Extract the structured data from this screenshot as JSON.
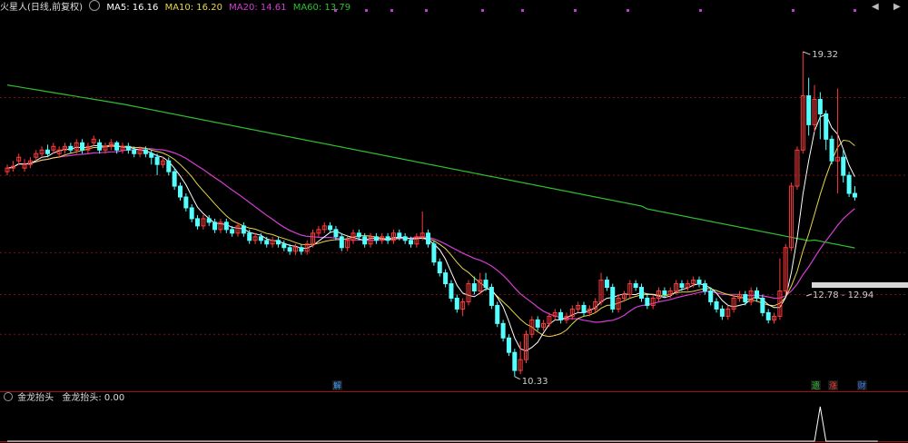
{
  "header": {
    "stock_name": "火星人(日线,前复权)",
    "ma5_label": "MA5: 16.16",
    "ma10_label": "MA10: 16.20",
    "ma20_label": "MA20: 14.61",
    "ma60_label": "MA60: 13.79",
    "prev_arrow": "◀",
    "next_arrow": "▶"
  },
  "colors": {
    "up": "#ff3b3b",
    "down": "#54ffff",
    "ma5": "#ffffff",
    "ma10": "#e8d64a",
    "ma20": "#d43ed4",
    "ma60": "#2fc02f",
    "grid": "#7a1010",
    "label": "#cfcfcf"
  },
  "annotations": {
    "high_label": "19.32",
    "low_label": "10.33",
    "range_label": "12.78 - 12.94"
  },
  "markers": [
    {
      "text": "解",
      "color": "#3fa0ff",
      "index": 57
    },
    {
      "text": "遗",
      "color": "#2fc02f",
      "index": 140
    },
    {
      "text": "涨",
      "color": "#ff3b3b",
      "index": 143
    },
    {
      "text": "财",
      "color": "#3f7fff",
      "index": 148
    }
  ],
  "indicator": {
    "name": "金龙抬头",
    "value_label": "金龙抬头: 0.00"
  },
  "chart_data": {
    "type": "candlestick",
    "ylim": [
      10.0,
      20.4
    ],
    "grid_levels": [
      18.05,
      15.9,
      13.76,
      12.6,
      11.5
    ],
    "candles": [
      [
        16.0,
        16.1,
        16.2,
        15.9
      ],
      [
        16.1,
        16.15,
        16.3,
        16.0
      ],
      [
        16.3,
        16.4,
        16.5,
        16.2
      ],
      [
        16.1,
        16.2,
        16.35,
        16.0
      ],
      [
        16.2,
        16.3,
        16.4,
        16.1
      ],
      [
        16.4,
        16.5,
        16.6,
        16.3
      ],
      [
        16.5,
        16.6,
        16.7,
        16.4
      ],
      [
        16.6,
        16.5,
        16.75,
        16.4
      ],
      [
        16.6,
        16.7,
        16.8,
        16.5
      ],
      [
        16.5,
        16.6,
        16.7,
        16.4
      ],
      [
        16.6,
        16.7,
        16.8,
        16.5
      ],
      [
        16.7,
        16.6,
        16.8,
        16.5
      ],
      [
        16.6,
        16.8,
        16.9,
        16.5
      ],
      [
        16.8,
        16.6,
        16.9,
        16.5
      ],
      [
        16.6,
        16.7,
        16.8,
        16.5
      ],
      [
        16.8,
        16.9,
        17.0,
        16.7
      ],
      [
        16.8,
        16.6,
        16.9,
        16.5
      ],
      [
        16.6,
        16.7,
        16.8,
        16.5
      ],
      [
        16.7,
        16.8,
        16.9,
        16.6
      ],
      [
        16.8,
        16.6,
        16.85,
        16.5
      ],
      [
        16.6,
        16.7,
        16.8,
        16.5
      ],
      [
        16.7,
        16.6,
        16.8,
        16.5
      ],
      [
        16.6,
        16.5,
        16.7,
        16.4
      ],
      [
        16.5,
        16.6,
        16.7,
        16.4
      ],
      [
        16.6,
        16.5,
        16.7,
        16.4
      ],
      [
        16.5,
        16.4,
        16.6,
        16.2
      ],
      [
        16.4,
        16.2,
        16.5,
        15.9
      ],
      [
        16.2,
        16.3,
        16.4,
        16.1
      ],
      [
        16.3,
        16.0,
        16.4,
        15.9
      ],
      [
        16.0,
        15.6,
        16.1,
        15.5
      ],
      [
        15.6,
        15.3,
        15.7,
        15.2
      ],
      [
        15.3,
        15.0,
        15.4,
        14.9
      ],
      [
        15.0,
        14.7,
        15.1,
        14.6
      ],
      [
        14.7,
        14.5,
        14.8,
        14.4
      ],
      [
        14.5,
        14.7,
        14.8,
        14.4
      ],
      [
        14.7,
        14.6,
        14.8,
        14.5
      ],
      [
        14.6,
        14.4,
        14.7,
        14.3
      ],
      [
        14.4,
        14.6,
        14.7,
        14.3
      ],
      [
        14.6,
        14.4,
        14.7,
        14.3
      ],
      [
        14.4,
        14.3,
        14.5,
        14.2
      ],
      [
        14.3,
        14.5,
        14.6,
        14.2
      ],
      [
        14.5,
        14.3,
        14.6,
        14.2
      ],
      [
        14.3,
        14.1,
        14.4,
        14.0
      ],
      [
        14.1,
        14.2,
        14.3,
        14.0
      ],
      [
        14.2,
        14.1,
        14.3,
        14.0
      ],
      [
        14.1,
        14.0,
        14.2,
        13.9
      ],
      [
        14.0,
        14.1,
        14.2,
        13.9
      ],
      [
        14.1,
        14.0,
        14.2,
        13.9
      ],
      [
        14.0,
        13.9,
        14.1,
        13.8
      ],
      [
        13.9,
        13.8,
        14.0,
        13.7
      ],
      [
        13.8,
        13.9,
        14.0,
        13.7
      ],
      [
        13.9,
        13.8,
        14.0,
        13.7
      ],
      [
        13.8,
        14.0,
        14.1,
        13.7
      ],
      [
        14.0,
        14.3,
        14.4,
        13.9
      ],
      [
        14.3,
        14.4,
        14.5,
        14.2
      ],
      [
        14.4,
        14.5,
        14.6,
        14.3
      ],
      [
        14.5,
        14.4,
        14.6,
        14.3
      ],
      [
        14.4,
        14.2,
        14.5,
        14.1
      ],
      [
        14.2,
        13.9,
        14.3,
        13.8
      ],
      [
        13.9,
        14.1,
        14.2,
        13.8
      ],
      [
        14.1,
        14.3,
        14.4,
        14.0
      ],
      [
        14.3,
        14.2,
        14.4,
        14.1
      ],
      [
        14.2,
        14.0,
        14.3,
        13.9
      ],
      [
        14.0,
        14.2,
        14.3,
        13.9
      ],
      [
        14.2,
        14.1,
        14.3,
        14.0
      ],
      [
        14.1,
        14.2,
        14.3,
        14.0
      ],
      [
        14.2,
        14.1,
        14.3,
        14.0
      ],
      [
        14.1,
        14.3,
        14.4,
        14.0
      ],
      [
        14.3,
        14.2,
        14.4,
        14.1
      ],
      [
        14.2,
        14.1,
        14.3,
        14.0
      ],
      [
        14.1,
        14.0,
        14.2,
        13.9
      ],
      [
        14.0,
        14.2,
        14.3,
        13.9
      ],
      [
        14.2,
        14.3,
        14.9,
        14.1
      ],
      [
        14.3,
        14.0,
        14.4,
        13.9
      ],
      [
        14.0,
        13.5,
        14.1,
        13.4
      ],
      [
        13.5,
        13.2,
        13.6,
        13.1
      ],
      [
        13.2,
        12.9,
        13.3,
        12.8
      ],
      [
        12.9,
        12.5,
        13.0,
        12.4
      ],
      [
        12.5,
        12.2,
        12.6,
        12.1
      ],
      [
        12.2,
        12.4,
        12.5,
        12.0
      ],
      [
        12.4,
        12.9,
        13.0,
        12.3
      ],
      [
        12.9,
        12.7,
        13.1,
        12.6
      ],
      [
        12.7,
        13.0,
        13.2,
        12.6
      ],
      [
        13.0,
        12.8,
        13.2,
        12.7
      ],
      [
        12.8,
        12.3,
        12.9,
        12.2
      ],
      [
        12.3,
        11.8,
        12.4,
        11.7
      ],
      [
        11.8,
        11.4,
        11.9,
        11.3
      ],
      [
        11.4,
        11.0,
        11.5,
        10.9
      ],
      [
        11.0,
        10.5,
        11.1,
        10.33
      ],
      [
        10.5,
        10.8,
        11.3,
        10.4
      ],
      [
        10.8,
        11.5,
        11.6,
        10.7
      ],
      [
        11.5,
        11.9,
        12.0,
        11.4
      ],
      [
        11.9,
        11.7,
        12.0,
        11.6
      ],
      [
        11.7,
        11.8,
        11.9,
        11.6
      ],
      [
        11.8,
        12.0,
        12.1,
        11.7
      ],
      [
        12.0,
        12.1,
        12.2,
        11.9
      ],
      [
        12.1,
        11.9,
        12.2,
        11.8
      ],
      [
        11.9,
        12.0,
        12.1,
        11.8
      ],
      [
        12.0,
        12.2,
        12.3,
        11.9
      ],
      [
        12.2,
        12.3,
        12.4,
        12.1
      ],
      [
        12.3,
        12.1,
        12.4,
        12.0
      ],
      [
        12.1,
        12.2,
        12.3,
        12.0
      ],
      [
        12.2,
        12.4,
        12.5,
        12.1
      ],
      [
        12.4,
        13.0,
        13.2,
        12.3
      ],
      [
        13.0,
        12.8,
        13.1,
        12.7
      ],
      [
        12.8,
        12.2,
        12.9,
        12.1
      ],
      [
        12.2,
        12.5,
        12.6,
        12.1
      ],
      [
        12.5,
        12.6,
        12.7,
        12.4
      ],
      [
        12.6,
        12.9,
        13.0,
        12.5
      ],
      [
        12.9,
        12.8,
        13.0,
        12.7
      ],
      [
        12.8,
        12.5,
        12.9,
        12.4
      ],
      [
        12.5,
        12.3,
        12.6,
        12.2
      ],
      [
        12.3,
        12.5,
        12.6,
        12.2
      ],
      [
        12.5,
        12.7,
        12.8,
        12.4
      ],
      [
        12.7,
        12.6,
        12.8,
        12.5
      ],
      [
        12.6,
        12.7,
        12.8,
        12.5
      ],
      [
        12.7,
        12.9,
        13.0,
        12.6
      ],
      [
        12.9,
        12.8,
        13.0,
        12.7
      ],
      [
        12.8,
        12.9,
        13.0,
        12.7
      ],
      [
        12.9,
        13.0,
        13.1,
        12.8
      ],
      [
        13.0,
        12.9,
        13.1,
        12.8
      ],
      [
        12.9,
        12.7,
        13.0,
        12.6
      ],
      [
        12.7,
        12.4,
        12.8,
        12.3
      ],
      [
        12.4,
        12.2,
        12.5,
        12.1
      ],
      [
        12.2,
        12.0,
        12.3,
        11.9
      ],
      [
        12.0,
        12.2,
        12.3,
        11.9
      ],
      [
        12.2,
        12.5,
        12.6,
        12.1
      ],
      [
        12.5,
        12.6,
        12.7,
        12.4
      ],
      [
        12.6,
        12.4,
        12.7,
        12.3
      ],
      [
        12.4,
        12.7,
        12.8,
        12.3
      ],
      [
        12.7,
        12.5,
        12.8,
        12.4
      ],
      [
        12.5,
        12.1,
        12.6,
        12.0
      ],
      [
        12.1,
        11.9,
        12.2,
        11.8
      ],
      [
        11.9,
        12.0,
        12.1,
        11.8
      ],
      [
        12.0,
        12.7,
        13.6,
        11.9
      ],
      [
        12.7,
        13.9,
        14.0,
        12.6
      ],
      [
        13.9,
        15.6,
        15.7,
        13.8
      ],
      [
        15.6,
        16.6,
        16.7,
        15.5
      ],
      [
        16.6,
        18.1,
        19.32,
        16.5
      ],
      [
        18.1,
        17.3,
        18.6,
        17.0
      ],
      [
        17.3,
        18.0,
        18.4,
        17.1
      ],
      [
        18.0,
        17.6,
        18.2,
        16.9
      ],
      [
        17.6,
        16.9,
        17.7,
        16.6
      ],
      [
        16.9,
        16.3,
        17.0,
        16.2
      ],
      [
        16.3,
        16.4,
        18.3,
        15.4
      ],
      [
        16.4,
        15.9,
        16.6,
        15.7
      ],
      [
        15.9,
        15.4,
        16.0,
        15.3
      ],
      [
        15.4,
        15.3,
        15.6,
        15.2
      ]
    ],
    "ma60_start": 18.4,
    "ma60_end": 13.79,
    "indicator_values": [
      0,
      0,
      0,
      0,
      0,
      0,
      0,
      0,
      0,
      0,
      0,
      0,
      0,
      0,
      0,
      0,
      0,
      0,
      0,
      0,
      0,
      0,
      0,
      0,
      0,
      0,
      0,
      0,
      0,
      0,
      0,
      0,
      0,
      0,
      0,
      0,
      0,
      0,
      0,
      0,
      0,
      0,
      0,
      0,
      0,
      0,
      0,
      0,
      0,
      0,
      0,
      0,
      0,
      0,
      0,
      0,
      0,
      0,
      0,
      0,
      0,
      0,
      0,
      0,
      0,
      0,
      0,
      0,
      0,
      0,
      0,
      0,
      0,
      0,
      0,
      0,
      0,
      0,
      0,
      0,
      0,
      0,
      0,
      0,
      0,
      0,
      0,
      0,
      0,
      0,
      0,
      0,
      0,
      0,
      0,
      0,
      0,
      0,
      0,
      0,
      0,
      0,
      0,
      0,
      0,
      0,
      0,
      0,
      0,
      0,
      0,
      0,
      0,
      0,
      0,
      0,
      0,
      0,
      0,
      0,
      0,
      0,
      0,
      0,
      0,
      0,
      0,
      0,
      0,
      0,
      0,
      0,
      0,
      0,
      0,
      0,
      0,
      0,
      0,
      0,
      0,
      1,
      0,
      0,
      0,
      0,
      0,
      0,
      0,
      0,
      0,
      0
    ]
  }
}
